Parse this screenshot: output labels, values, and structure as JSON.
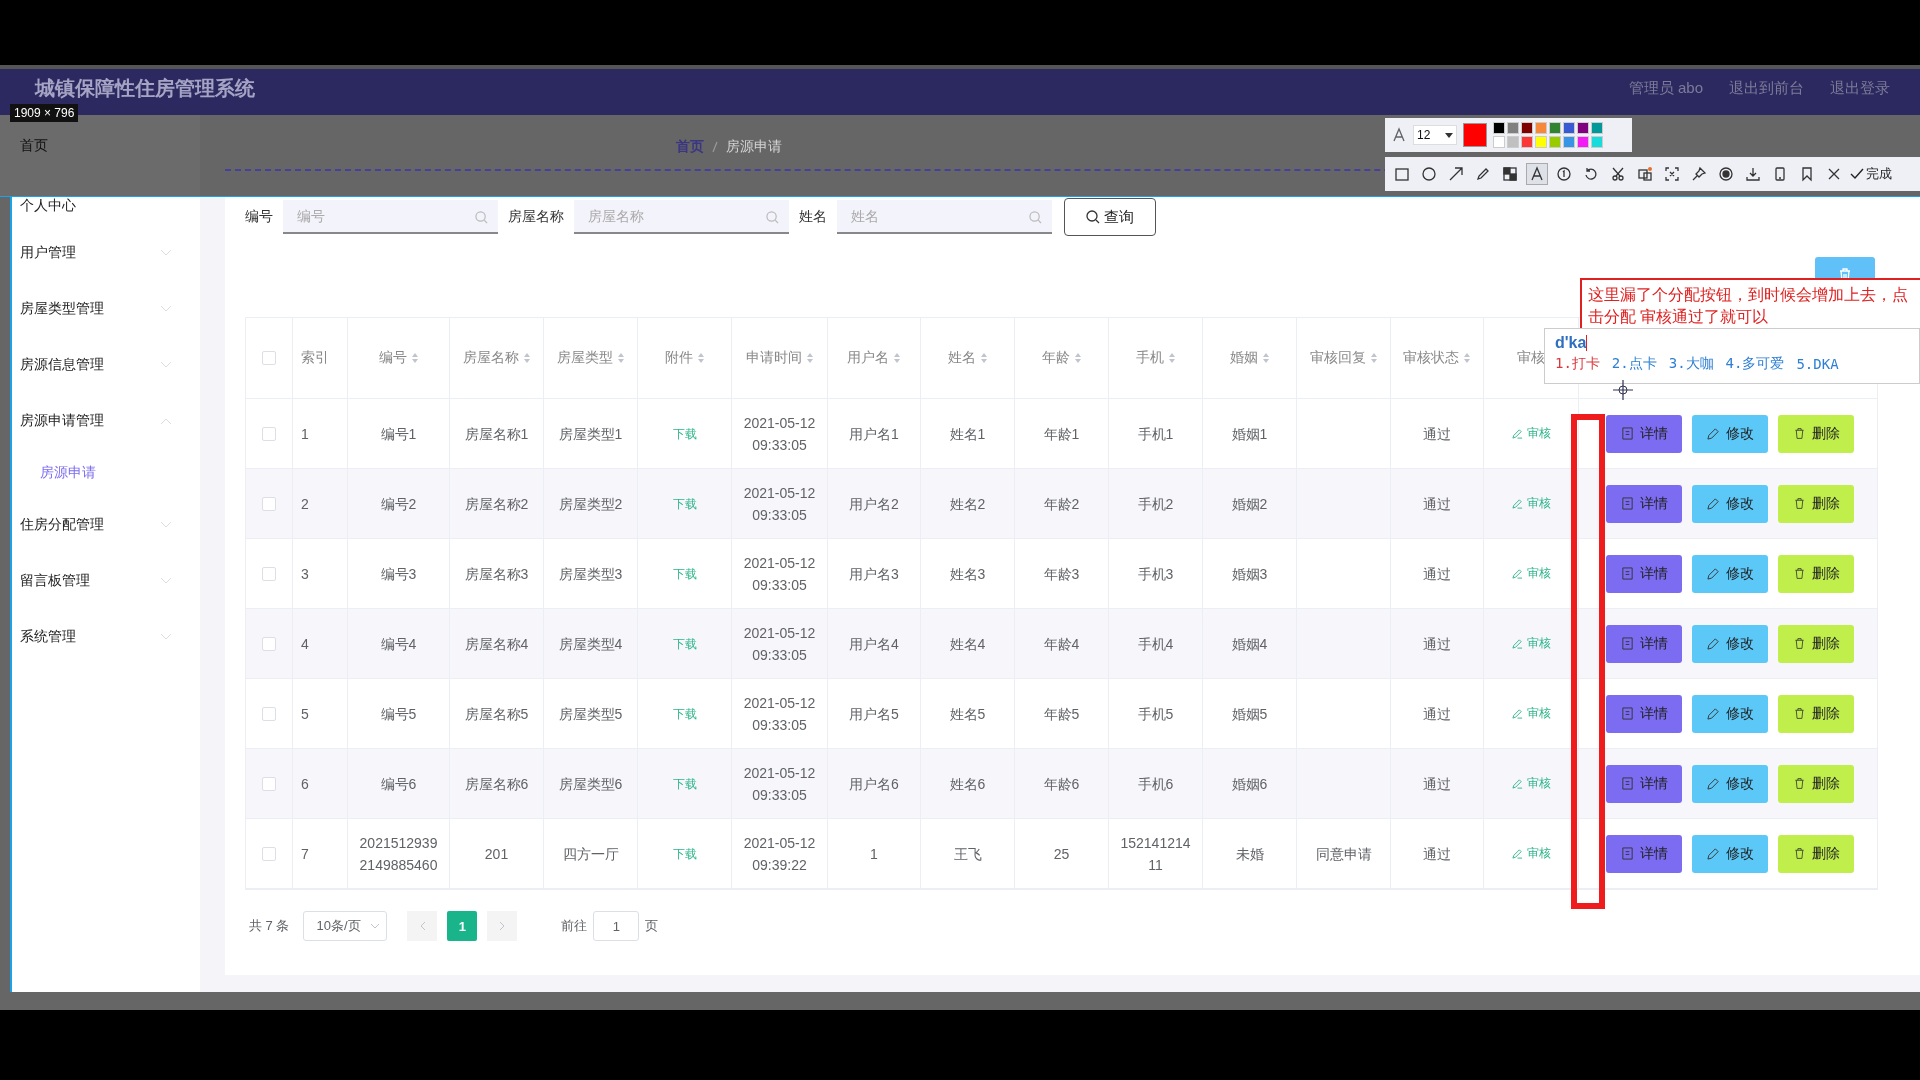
{
  "header": {
    "title": "城镇保障性住房管理系统",
    "links": [
      "管理员 abo",
      "退出到前台",
      "退出登录"
    ]
  },
  "sidebar": {
    "links": [
      "首页",
      "个人中心"
    ],
    "menus": [
      {
        "label": "用户管理",
        "expanded": false
      },
      {
        "label": "房屋类型管理",
        "expanded": false
      },
      {
        "label": "房源信息管理",
        "expanded": false
      },
      {
        "label": "房源申请管理",
        "expanded": true,
        "children": [
          {
            "label": "房源申请",
            "selected": true
          }
        ]
      },
      {
        "label": "住房分配管理",
        "expanded": false
      },
      {
        "label": "留言板管理",
        "expanded": false
      },
      {
        "label": "系统管理",
        "expanded": false
      }
    ]
  },
  "breadcrumb": [
    "首页",
    "房源申请"
  ],
  "search": {
    "fields": [
      {
        "label": "编号",
        "placeholder": "编号"
      },
      {
        "label": "房屋名称",
        "placeholder": "房屋名称"
      },
      {
        "label": "姓名",
        "placeholder": "姓名"
      }
    ],
    "button": "查询"
  },
  "table": {
    "select_all_checked": false,
    "columns": [
      {
        "label": "索引",
        "sortable": false
      },
      {
        "label": "编号",
        "sortable": true
      },
      {
        "label": "房屋名称",
        "sortable": true
      },
      {
        "label": "房屋类型",
        "sortable": true
      },
      {
        "label": "附件",
        "sortable": true
      },
      {
        "label": "申请时间",
        "sortable": true
      },
      {
        "label": "用户名",
        "sortable": true
      },
      {
        "label": "姓名",
        "sortable": true
      },
      {
        "label": "年龄",
        "sortable": true
      },
      {
        "label": "手机",
        "sortable": true
      },
      {
        "label": "婚姻",
        "sortable": true
      },
      {
        "label": "审核回复",
        "sortable": true
      },
      {
        "label": "审核状态",
        "sortable": true
      },
      {
        "label": "审核",
        "sortable": false
      }
    ],
    "rows": [
      {
        "checked": false,
        "index": "1",
        "code": "编号1",
        "house_name": "房屋名称1",
        "house_type": "房屋类型1",
        "attachment": "下载",
        "time": "2021-05-12 09:33:05",
        "username": "用户名1",
        "name": "姓名1",
        "age": "年龄1",
        "phone": "手机1",
        "marital": "婚姻1",
        "status": "通过",
        "review": "审核",
        "actions": [
          "详情",
          "修改",
          "删除"
        ]
      },
      {
        "checked": false,
        "index": "2",
        "code": "编号2",
        "house_name": "房屋名称2",
        "house_type": "房屋类型2",
        "attachment": "下载",
        "time": "2021-05-12 09:33:05",
        "username": "用户名2",
        "name": "姓名2",
        "age": "年龄2",
        "phone": "手机2",
        "marital": "婚姻2",
        "status": "通过",
        "review": "审核",
        "actions": [
          "详情",
          "修改",
          "删除"
        ]
      },
      {
        "checked": false,
        "index": "3",
        "code": "编号3",
        "house_name": "房屋名称3",
        "house_type": "房屋类型3",
        "attachment": "下载",
        "time": "2021-05-12 09:33:05",
        "username": "用户名3",
        "name": "姓名3",
        "age": "年龄3",
        "phone": "手机3",
        "marital": "婚姻3",
        "status": "通过",
        "review": "审核",
        "actions": [
          "详情",
          "修改",
          "删除"
        ]
      },
      {
        "checked": false,
        "index": "4",
        "code": "编号4",
        "house_name": "房屋名称4",
        "house_type": "房屋类型4",
        "attachment": "下载",
        "time": "2021-05-12 09:33:05",
        "username": "用户名4",
        "name": "姓名4",
        "age": "年龄4",
        "phone": "手机4",
        "marital": "婚姻4",
        "status": "通过",
        "review": "审核",
        "actions": [
          "详情",
          "修改",
          "删除"
        ]
      },
      {
        "checked": false,
        "index": "5",
        "code": "编号5",
        "house_name": "房屋名称5",
        "house_type": "房屋类型5",
        "attachment": "下载",
        "time": "2021-05-12 09:33:05",
        "username": "用户名5",
        "name": "姓名5",
        "age": "年龄5",
        "phone": "手机5",
        "marital": "婚姻5",
        "status": "通过",
        "review": "审核",
        "actions": [
          "详情",
          "修改",
          "删除"
        ]
      },
      {
        "checked": false,
        "index": "6",
        "code": "编号6",
        "house_name": "房屋名称6",
        "house_type": "房屋类型6",
        "attachment": "下载",
        "time": "2021-05-12 09:33:05",
        "username": "用户名6",
        "name": "姓名6",
        "age": "年龄6",
        "phone": "手机6",
        "marital": "婚姻6",
        "status": "通过",
        "review": "审核",
        "actions": [
          "详情",
          "修改",
          "删除"
        ]
      },
      {
        "checked": false,
        "index": "7",
        "code": "20215129392149885460",
        "house_name": "201",
        "house_type": "四方一厅",
        "attachment": "下载",
        "time": "2021-05-12 09:39:22",
        "username": "1",
        "name": "王飞",
        "age": "25",
        "phone": "15214121411",
        "marital": "未婚",
        "reply": "同意申请",
        "status": "通过",
        "review": "审核",
        "actions": [
          "详情",
          "修改",
          "删除"
        ]
      }
    ]
  },
  "pagination": {
    "total": "共 7 条",
    "page_size": "10条/页",
    "pages": [
      {
        "label": "1",
        "selected": true
      }
    ],
    "goto_label": "前往",
    "goto_value": "1",
    "goto_suffix": "页"
  },
  "capture_tool": {
    "size_label": "1909 × 796",
    "font_size": "12",
    "current_swatch": {
      "color": "#ff0000"
    },
    "swatches": [
      {
        "color": "#000000"
      },
      {
        "color": "#808080"
      },
      {
        "color": "#800000"
      },
      {
        "color": "#f7883a"
      },
      {
        "color": "#308430"
      },
      {
        "color": "#385ad3"
      },
      {
        "color": "#800080"
      },
      {
        "color": "#009999"
      },
      {
        "color": "#ffffff"
      },
      {
        "color": "#c0c0c0"
      },
      {
        "color": "#fb3838"
      },
      {
        "color": "#ffff00"
      },
      {
        "color": "#99cc00"
      },
      {
        "color": "#3894e4"
      },
      {
        "color": "#f31bf3"
      },
      {
        "color": "#16dcdc"
      }
    ],
    "tools": [
      {
        "kind": "rectangle",
        "selected": false
      },
      {
        "kind": "ellipse",
        "selected": false
      },
      {
        "kind": "arrow",
        "selected": false
      },
      {
        "kind": "pencil",
        "selected": false
      },
      {
        "kind": "mosaic",
        "selected": false
      },
      {
        "kind": "text",
        "selected": true
      },
      {
        "kind": "number",
        "selected": false
      },
      {
        "kind": "undo",
        "selected": false
      },
      {
        "kind": "cut",
        "selected": false
      },
      {
        "kind": "translate",
        "selected": false
      },
      {
        "kind": "scan",
        "selected": false
      },
      {
        "kind": "pin",
        "selected": false
      },
      {
        "kind": "record",
        "selected": false
      },
      {
        "kind": "download",
        "selected": false
      },
      {
        "kind": "phone",
        "selected": false
      },
      {
        "kind": "bookmark",
        "selected": false
      },
      {
        "kind": "close",
        "selected": false
      }
    ],
    "done_label": "完成"
  },
  "annotation": {
    "text": "这里漏了个分配按钮，到时候会增加上去，点击分配 审核通过了就可以"
  },
  "ime": {
    "input": "d'ka",
    "candidates": [
      {
        "label": "1.打卡",
        "selected": true
      },
      {
        "label": "2.点卡",
        "selected": false
      },
      {
        "label": "3.大咖",
        "selected": false
      },
      {
        "label": "4.多可爱",
        "selected": false
      },
      {
        "label": "5.DKA",
        "selected": false
      }
    ]
  }
}
